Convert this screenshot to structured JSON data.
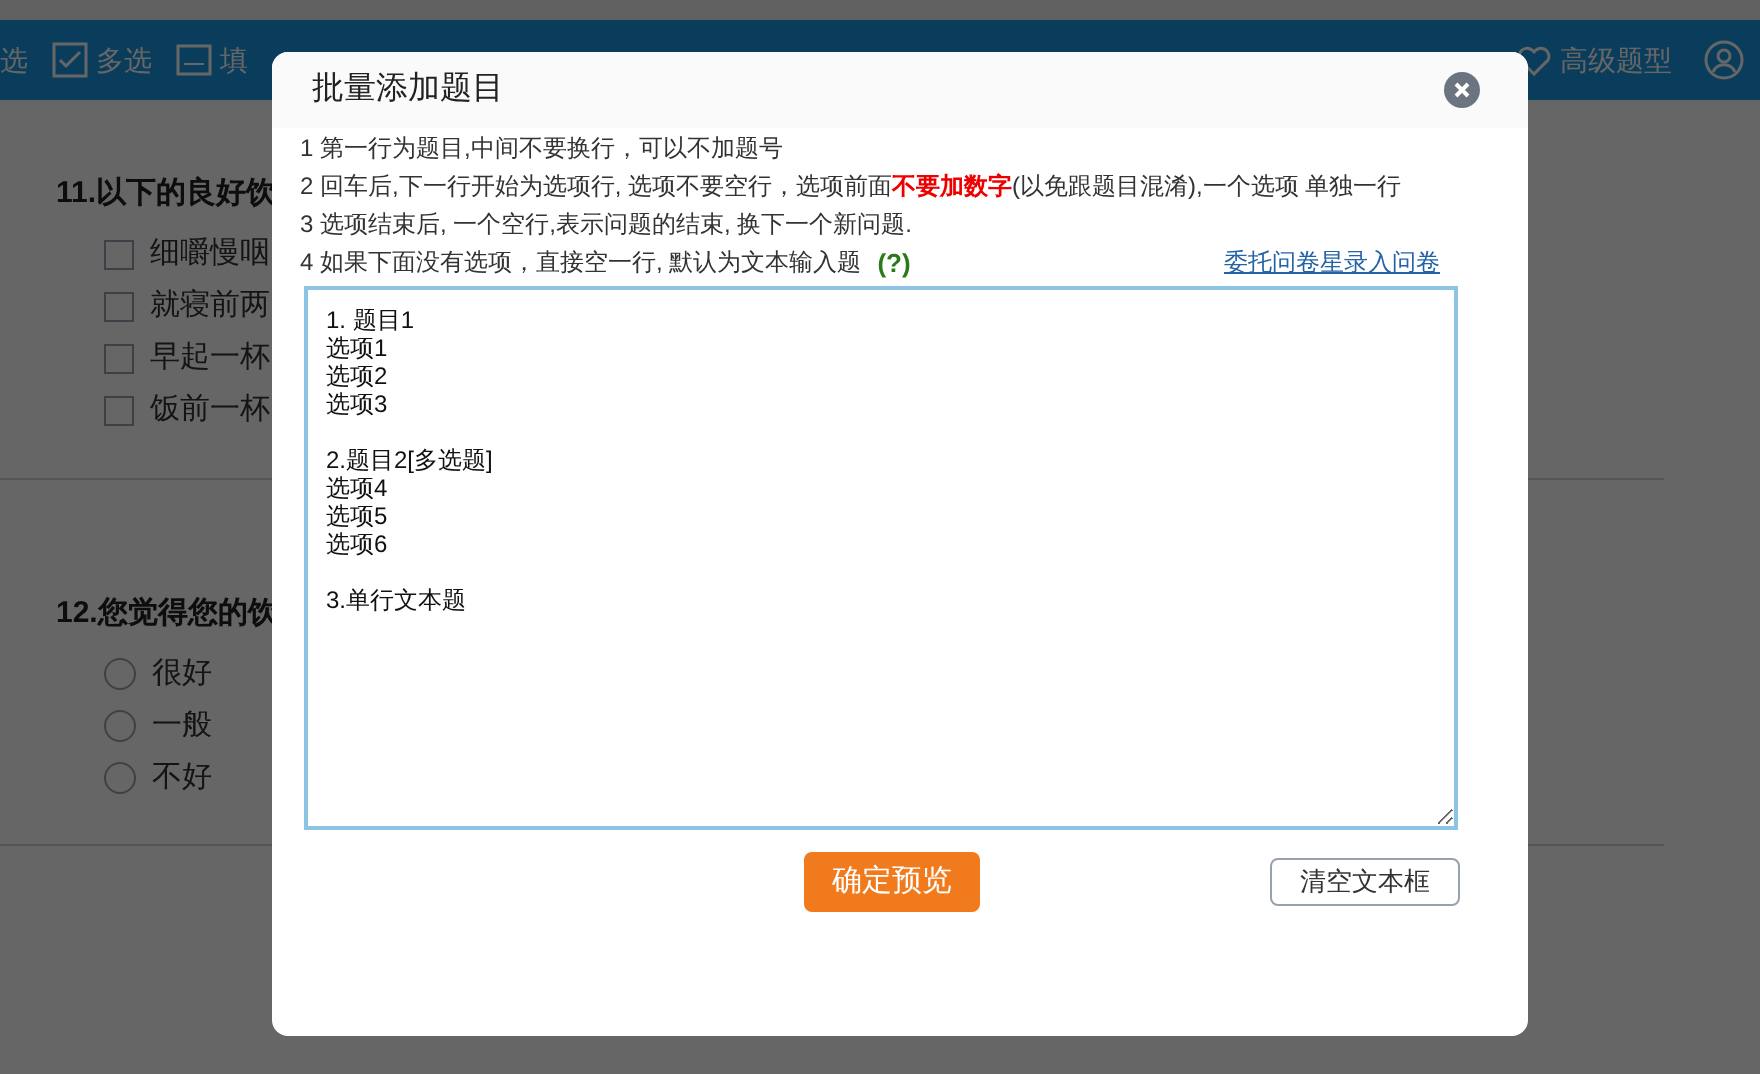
{
  "toolbar": {
    "items": [
      {
        "kind": "plain",
        "label": "选"
      },
      {
        "kind": "checkbox",
        "label": "多选"
      },
      {
        "kind": "text",
        "label": "填"
      }
    ],
    "right_items": [
      {
        "kind": "heart",
        "label": "高级题型"
      },
      {
        "kind": "user"
      }
    ]
  },
  "questions": [
    {
      "kind": "checkbox",
      "title": "11.以下的良好饮",
      "options": [
        {
          "label": "细嚼慢咽",
          "checked": false
        },
        {
          "label": "就寝前两",
          "checked": false
        },
        {
          "label": "早起一杯",
          "checked": false
        },
        {
          "label": "饭前一杯",
          "checked": false
        }
      ]
    },
    {
      "kind": "radio",
      "title": "12.您觉得您的饮",
      "options": [
        {
          "label": "很好",
          "selected": false
        },
        {
          "label": "一般",
          "selected": false
        },
        {
          "label": "不好",
          "selected": false
        }
      ]
    }
  ],
  "dialog": {
    "title": "批量添加题目",
    "instructions": [
      "1 第一行为题目,中间不要换行，可以不加题号",
      "2 回车后,下一行开始为选项行, 选项不要空行，选项前面**不要加数字**(以免跟题目混淆),一个选项 单独一行",
      "3 选项结束后, 一个空行,表示问题的结束, 换下一个新问题.",
      "4 如果下面没有选项，直接空一行, 默认为文本输入题"
    ],
    "help": "(?)",
    "link": "委托问卷星录入问卷",
    "textarea": {
      "value": "1. 题目1\n选项1\n选项2\n选项3\n\n2.题目2[多选题]\n选项4\n选项5\n选项6\n\n3.单行文本题"
    },
    "primary_button": "确定预览",
    "secondary_button": "清空文本框"
  }
}
